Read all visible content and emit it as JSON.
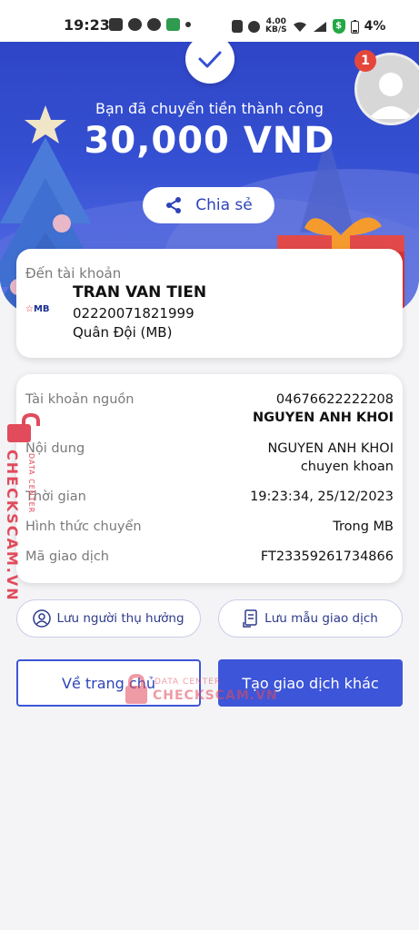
{
  "status_bar": {
    "time": "19:23",
    "speed_value": "4.00",
    "speed_unit": "KB/S",
    "battery": "4%"
  },
  "hero": {
    "subtitle": "Bạn đã chuyển tiền thành công",
    "amount": "30,000 VND",
    "share_label": "Chia sẻ",
    "notification_count": "1"
  },
  "recipient": {
    "label": "Đến tài khoản",
    "name": "TRAN VAN TIEN",
    "account_number": "02220071821999",
    "bank": "Quân Đội (MB)",
    "bank_logo_text": "MB"
  },
  "details": [
    {
      "label": "Tài khoản nguồn",
      "value": "04676622222208",
      "value2": "NGUYEN ANH KHOI"
    },
    {
      "label": "Nội dung",
      "value": "NGUYEN ANH KHOI",
      "value2": "chuyen khoan"
    },
    {
      "label": "Thời gian",
      "value": "19:23:34, 25/12/2023"
    },
    {
      "label": "Hình thức chuyển",
      "value": "Trong MB"
    },
    {
      "label": "Mã giao dịch",
      "value": "FT23359261734866"
    }
  ],
  "actions": {
    "save_recipient": "Lưu người thụ hưởng",
    "save_template": "Lưu mẫu giao dịch",
    "home": "Về trang chủ",
    "new_transaction": "Tạo giao dịch khác"
  },
  "watermark": {
    "main": "CHECKSCAM.VN",
    "sub": "DATA CENTER"
  },
  "colors": {
    "primary": "#3d55d8",
    "hero": "#3550d2",
    "watermark": "#e14b5c"
  }
}
